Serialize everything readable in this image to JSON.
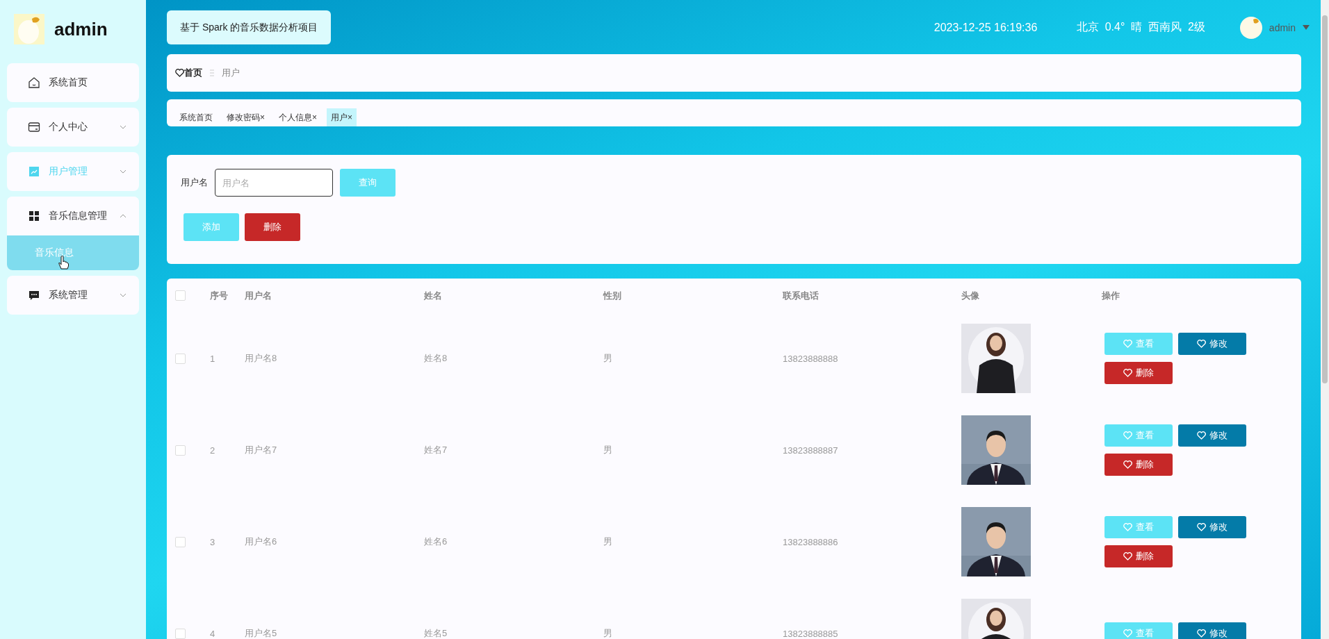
{
  "sidebar": {
    "brand": "admin",
    "items": [
      {
        "label": "系统首页",
        "selected": false
      },
      {
        "label": "个人中心",
        "expanded": false,
        "selected": false
      },
      {
        "label": "用户管理",
        "expanded": false,
        "selected": true
      },
      {
        "label": "音乐信息管理",
        "expanded": true,
        "selected": false,
        "children": [
          {
            "label": "音乐信息",
            "selected": true
          }
        ]
      },
      {
        "label": "系统管理",
        "expanded": false,
        "selected": false
      }
    ]
  },
  "header": {
    "title": "基于 Spark 的音乐数据分析项目",
    "datetime": "2023-12-25 16:19:36",
    "weather": "北京  0.4°  晴  西南风  2级",
    "user": "admin"
  },
  "breadcrumb": [
    "首页",
    "用户"
  ],
  "tabs": [
    {
      "label": "系统首页",
      "selected": false
    },
    {
      "label": "修改密码",
      "close": "×",
      "selected": false
    },
    {
      "label": "个人信息",
      "close": "×",
      "selected": false
    },
    {
      "label": "用户",
      "close": "×",
      "selected": true
    }
  ],
  "filter": {
    "label": "用户名",
    "placeholder": "用户名",
    "search_button": "查询",
    "buttons": [
      {
        "label": "添加",
        "kind": "add"
      },
      {
        "label": "删除",
        "kind": "delete"
      }
    ]
  },
  "table": {
    "header_checked": false,
    "columns": [
      "序号",
      "用户名",
      "姓名",
      "性别",
      "联系电话",
      "头像",
      "操作"
    ],
    "rows": [
      {
        "checked": false,
        "index": "1",
        "username": "用户名8",
        "name": "姓名8",
        "gender": "男",
        "phone": "13823888888",
        "avatar": {
          "kind": "picture"
        },
        "actions": [
          {
            "label": "查看",
            "kind": "view"
          },
          {
            "label": "修改",
            "kind": "edit"
          },
          {
            "label": "删除",
            "kind": "delete"
          }
        ]
      },
      {
        "checked": false,
        "index": "2",
        "username": "用户名7",
        "name": "姓名7",
        "gender": "男",
        "phone": "13823888887",
        "avatar": {
          "kind": "picture"
        },
        "actions": [
          {
            "label": "查看",
            "kind": "view"
          },
          {
            "label": "修改",
            "kind": "edit"
          },
          {
            "label": "删除",
            "kind": "delete"
          }
        ]
      },
      {
        "checked": false,
        "index": "3",
        "username": "用户名6",
        "name": "姓名6",
        "gender": "男",
        "phone": "13823888886",
        "avatar": {
          "kind": "picture"
        },
        "actions": [
          {
            "label": "查看",
            "kind": "view"
          },
          {
            "label": "修改",
            "kind": "edit"
          },
          {
            "label": "删除",
            "kind": "delete"
          }
        ]
      },
      {
        "checked": false,
        "index": "4",
        "username": "用户名5",
        "name": "姓名5",
        "gender": "男",
        "phone": "13823888885",
        "avatar": {
          "kind": "picture"
        },
        "actions": [
          {
            "label": "查看",
            "kind": "view"
          },
          {
            "label": "修改",
            "kind": "edit"
          }
        ]
      }
    ]
  }
}
